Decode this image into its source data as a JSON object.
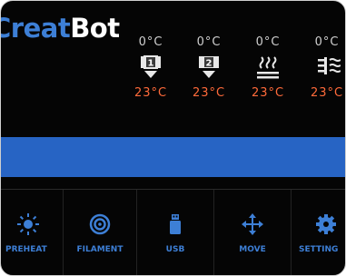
{
  "brand": {
    "logo_left": "CreatBot"
  },
  "temperatures": [
    {
      "id": "extruder-1",
      "icon": "extruder-1-icon",
      "badge": "1",
      "target": "0°C",
      "current": "23°C"
    },
    {
      "id": "extruder-2",
      "icon": "extruder-2-icon",
      "badge": "2",
      "target": "0°C",
      "current": "23°C"
    },
    {
      "id": "heated-bed",
      "icon": "heated-bed-icon",
      "target": "0°C",
      "current": "23°C"
    },
    {
      "id": "chamber",
      "icon": "chamber-heater-icon",
      "target": "0°C",
      "current": "23°C"
    }
  ],
  "status_bar": {
    "message": ""
  },
  "menu": [
    {
      "id": "preheat",
      "icon": "sun-icon",
      "label": "PREHEAT"
    },
    {
      "id": "filament",
      "icon": "filament-spool-icon",
      "label": "FILAMENT"
    },
    {
      "id": "usb",
      "icon": "usb-drive-icon",
      "label": "USB"
    },
    {
      "id": "move",
      "icon": "move-arrows-icon",
      "label": "MOVE"
    },
    {
      "id": "settings",
      "icon": "gear-icon",
      "label": "SETTING"
    }
  ],
  "colors": {
    "background": "#050505",
    "accent_blue": "#2764c4",
    "label_blue": "#3d7fd6",
    "current_temp_orange": "#ff6a3a",
    "target_temp_gray": "#cfcfcf"
  }
}
